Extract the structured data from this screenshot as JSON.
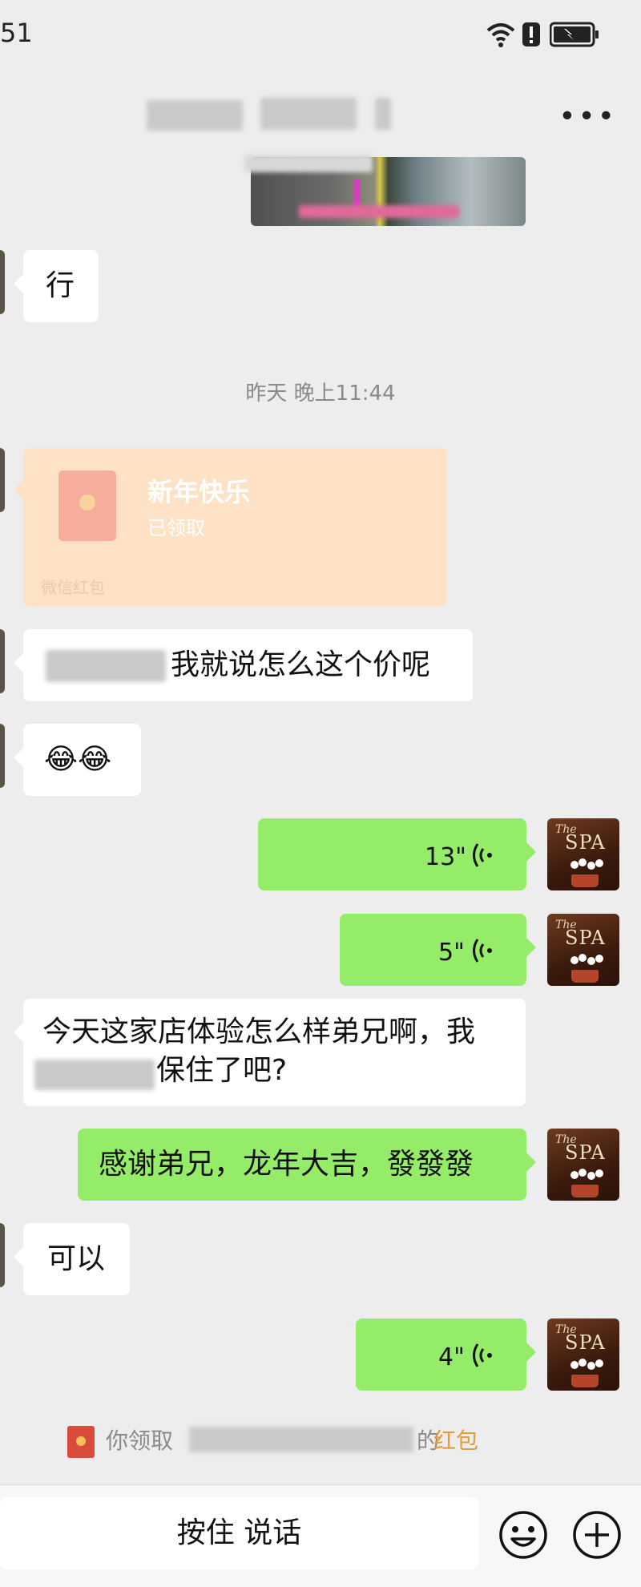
{
  "status_bar": {
    "time": "51"
  },
  "timestamp": "昨天 晚上11:44",
  "messages": {
    "m1": "行",
    "red_packet": {
      "title": "新年快乐",
      "status": "已领取",
      "label": "微信红包"
    },
    "m3_visible": "我就说怎么这个价呢",
    "m4_emoji": "😂😂",
    "voice1": "13\"",
    "voice2": "5\"",
    "m7_line1": "今天这家店体验怎么样弟兄啊，我",
    "m7_line2_visible": "保住了吧?",
    "m8": "感谢弟兄，龙年大吉，發發發",
    "m9": "可以",
    "voice3": "4\""
  },
  "system_notice": {
    "prefix": "你领取",
    "suffix": "的",
    "link": "红包"
  },
  "input": {
    "hold_label": "按住 说话"
  },
  "avatar_text": {
    "the": "The",
    "spa": "SPA"
  }
}
